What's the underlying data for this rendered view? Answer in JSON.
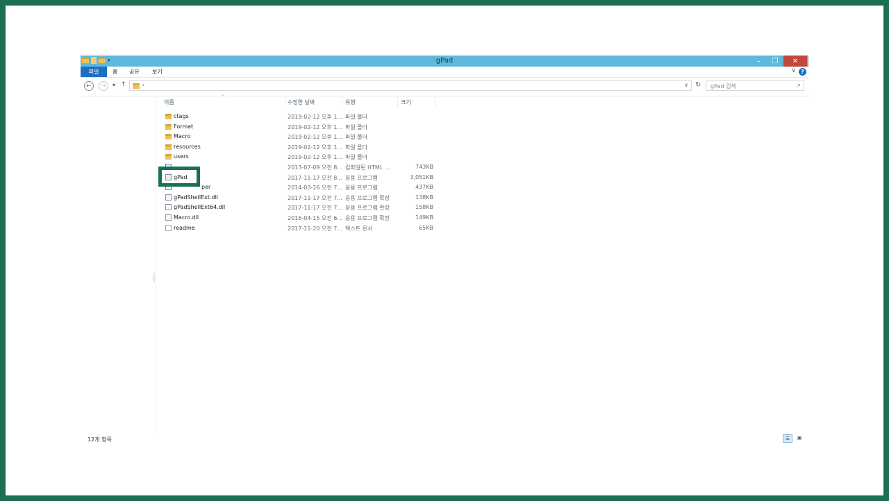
{
  "window": {
    "title": "gPad",
    "controls": {
      "minimize": "–",
      "maximize": "❐",
      "close": "✕"
    }
  },
  "quick_access": {
    "dropdown": "▾"
  },
  "ribbon": {
    "tabs": [
      {
        "label": "파일",
        "active": true
      },
      {
        "label": "홈"
      },
      {
        "label": "공유"
      },
      {
        "label": "보기"
      }
    ],
    "expand_glyph": "∨",
    "help_glyph": "?"
  },
  "address": {
    "back_glyph": "←",
    "forward_glyph": "→",
    "recent_glyph": "▾",
    "up_glyph": "↑",
    "separator": "›",
    "dropdown_glyph": "∨",
    "refresh_glyph": "↻",
    "search_placeholder": "gPad 검색",
    "search_glyph": "⌕"
  },
  "columns": {
    "name": "이름",
    "date": "수정한 날짜",
    "type": "유형",
    "size": "크기"
  },
  "files": [
    {
      "name": "ctags",
      "date": "2019-02-12 오후 1...",
      "type": "파일 폴더",
      "size": "",
      "icon": "folder-icon",
      "kind": "folder"
    },
    {
      "name": "Format",
      "date": "2019-02-12 오후 1...",
      "type": "파일 폴더",
      "size": "",
      "icon": "folder-icon",
      "kind": "folder"
    },
    {
      "name": "Macro",
      "date": "2019-02-12 오후 1...",
      "type": "파일 폴더",
      "size": "",
      "icon": "folder-icon",
      "kind": "folder"
    },
    {
      "name": "resources",
      "date": "2019-02-12 오후 1...",
      "type": "파일 폴더",
      "size": "",
      "icon": "folder-icon",
      "kind": "folder"
    },
    {
      "name": "users",
      "date": "2019-02-12 오후 1...",
      "type": "파일 폴더",
      "size": "",
      "icon": "folder-icon",
      "kind": "folder"
    },
    {
      "name": "",
      "date": "2013-07-09 오전 8...",
      "type": "컴파일된 HTML ...",
      "size": "743KB",
      "icon": "html-help-icon",
      "kind": "html"
    },
    {
      "name": "gPad",
      "date": "2017-11-17 오전 8...",
      "type": "응용 프로그램",
      "size": "3,051KB",
      "icon": "application-icon",
      "kind": "app"
    },
    {
      "name": "per",
      "date": "2014-03-26 오전 7...",
      "type": "응용 프로그램",
      "size": "437KB",
      "icon": "application-icon",
      "kind": "app"
    },
    {
      "name": "gPadShellExt.dll",
      "date": "2017-11-17 오전 7...",
      "type": "응용 프로그램 확장",
      "size": "138KB",
      "icon": "dll-icon",
      "kind": "dll"
    },
    {
      "name": "gPadShellExt64.dll",
      "date": "2017-11-17 오전 7...",
      "type": "응용 프로그램 확장",
      "size": "158KB",
      "icon": "dll-icon",
      "kind": "dll"
    },
    {
      "name": "Macro.dll",
      "date": "2016-04-15 오전 6...",
      "type": "응용 프로그램 확장",
      "size": "149KB",
      "icon": "dll-icon",
      "kind": "dll"
    },
    {
      "name": "readme",
      "date": "2017-11-20 오전 7...",
      "type": "텍스트 문서",
      "size": "65KB",
      "icon": "text-file-icon",
      "kind": "txt"
    }
  ],
  "status": {
    "item_count": "12개 항목"
  },
  "view_buttons": {
    "details": "☰",
    "large_icons": "▣"
  },
  "colors": {
    "titlebar": "#5eb9dc",
    "highlight_frame": "#1a7050",
    "close_button": "#c4473e",
    "file_tab": "#1e6fbf"
  }
}
